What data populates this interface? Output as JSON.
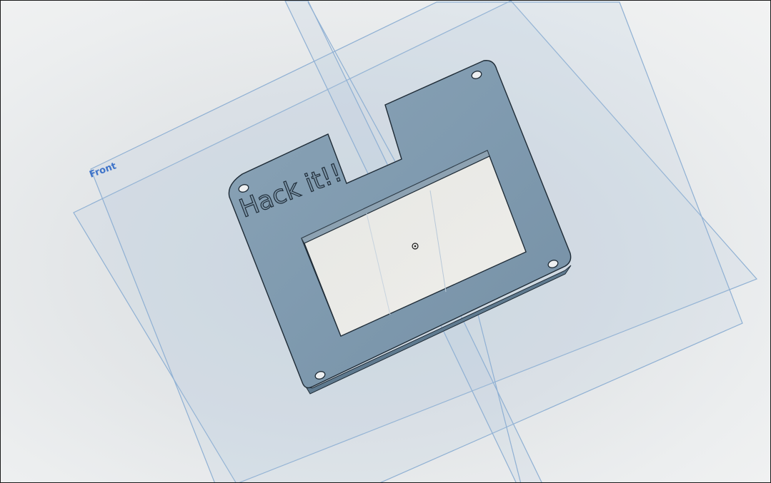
{
  "viewport": {
    "planes": {
      "front": {
        "label": "Front"
      }
    },
    "part": {
      "engraving": "Hack it!!"
    },
    "colors": {
      "part_face": "#7e99ae",
      "part_edge": "#5f7a8f",
      "plane_stroke": "#8fb0d3",
      "plane_label": "#3f74c9"
    },
    "origin_icon": "origin-point-icon"
  }
}
